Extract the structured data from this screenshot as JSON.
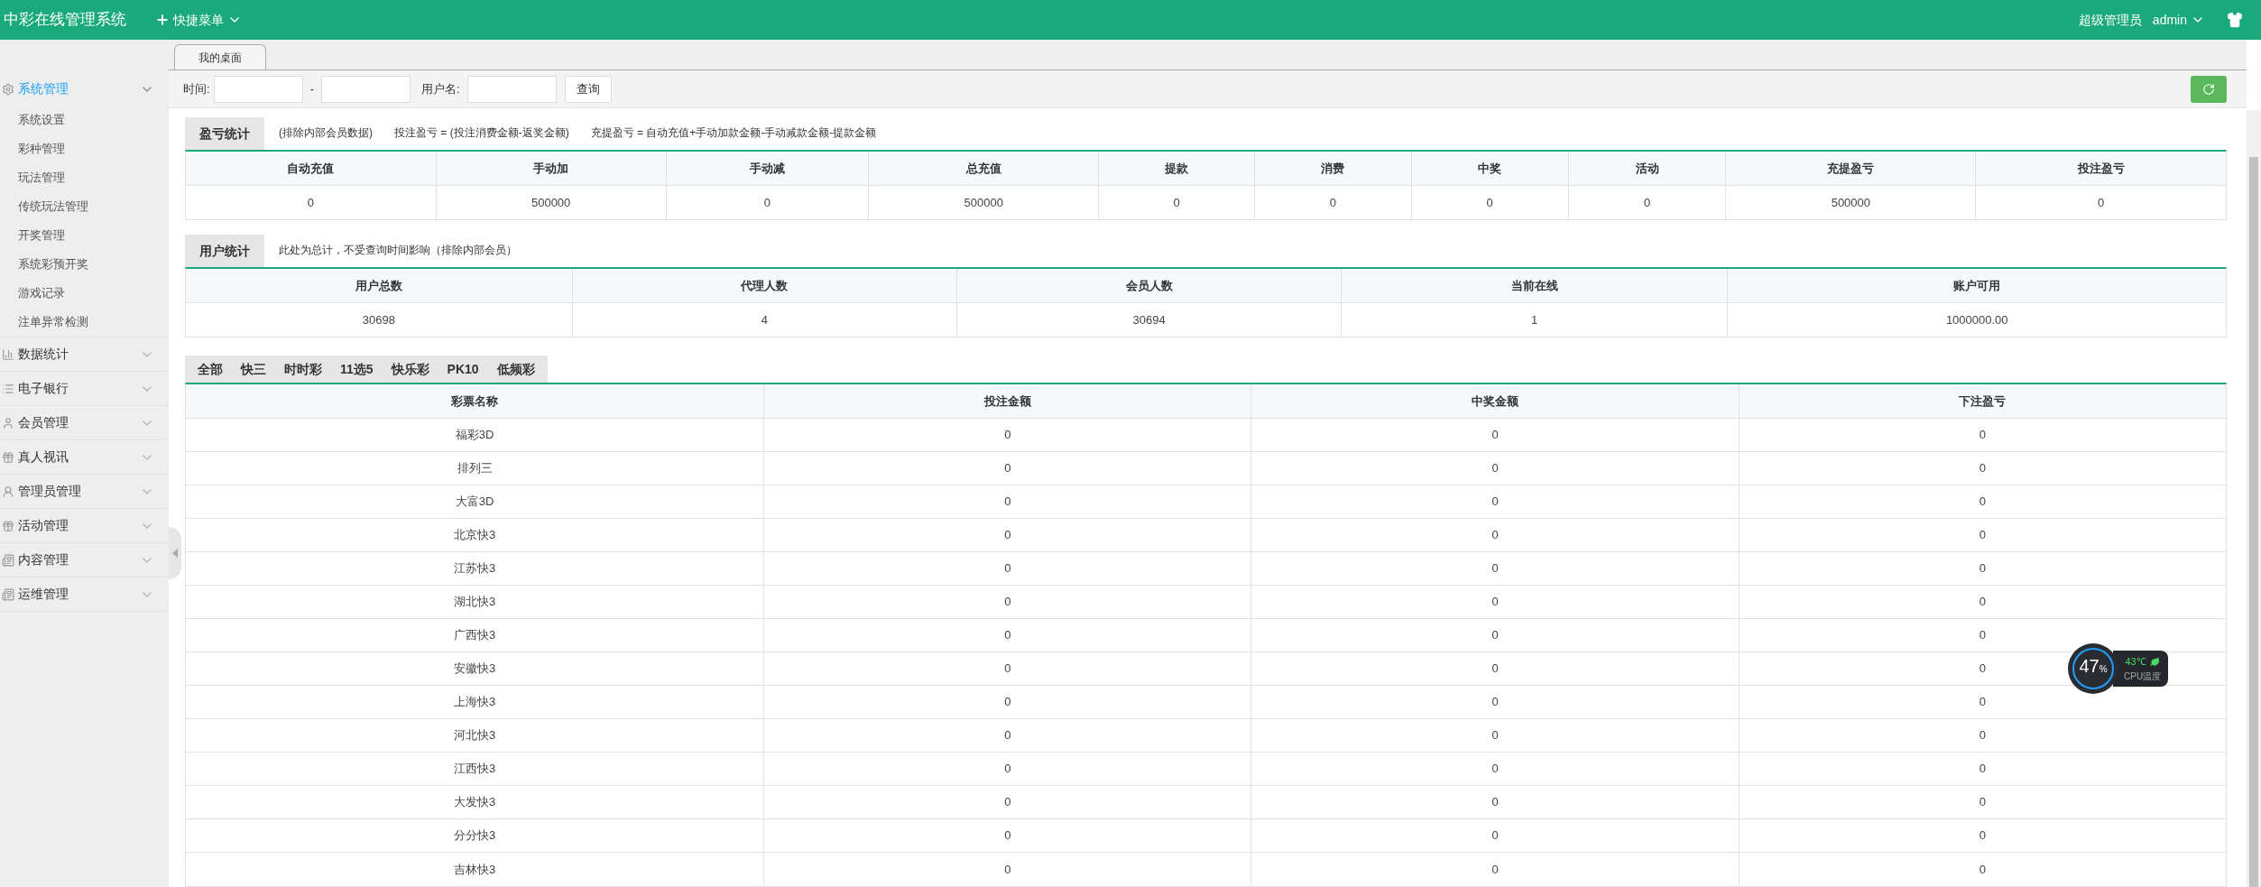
{
  "header": {
    "title": "中彩在线管理系统",
    "quick_menu": "快捷菜单",
    "role": "超级管理员",
    "user": "admin"
  },
  "sidebar": {
    "groups": [
      {
        "label": "系统管理",
        "expanded": true,
        "selected": true,
        "children": [
          {
            "label": "系统设置"
          },
          {
            "label": "彩种管理"
          },
          {
            "label": "玩法管理"
          },
          {
            "label": "传统玩法管理"
          },
          {
            "label": "开奖管理"
          },
          {
            "label": "系统彩预开奖"
          },
          {
            "label": "游戏记录"
          },
          {
            "label": "注单异常检测"
          }
        ]
      },
      {
        "label": "数据统计",
        "expanded": false,
        "selected": false
      },
      {
        "label": "电子银行",
        "expanded": false,
        "selected": false
      },
      {
        "label": "会员管理",
        "expanded": false,
        "selected": false
      },
      {
        "label": "真人视讯",
        "expanded": false,
        "selected": false
      },
      {
        "label": "管理员管理",
        "expanded": false,
        "selected": false
      },
      {
        "label": "活动管理",
        "expanded": false,
        "selected": false
      },
      {
        "label": "内容管理",
        "expanded": false,
        "selected": false
      },
      {
        "label": "运维管理",
        "expanded": false,
        "selected": false
      }
    ]
  },
  "page_tabs": [
    {
      "label": "我的桌面",
      "selected": true
    }
  ],
  "filter": {
    "time_label": "时间:",
    "separator": "-",
    "username_label": "用户名:",
    "search_button": "查询"
  },
  "profit_stats": {
    "title": "盈亏统计",
    "notes": [
      "(排除内部会员数据)",
      "投注盈亏 = (投注消费金额-返奖金额)",
      "充提盈亏 = 自动充值+手动加款金额-手动减款金额-提款金额"
    ],
    "columns": [
      "自动充值",
      "手动加",
      "手动减",
      "总充值",
      "提款",
      "消费",
      "中奖",
      "活动",
      "充提盈亏",
      "投注盈亏"
    ],
    "rows": [
      [
        "0",
        "500000",
        "0",
        "500000",
        "0",
        "0",
        "0",
        "0",
        "500000",
        "0"
      ]
    ]
  },
  "user_stats": {
    "title": "用户统计",
    "notes": [
      "此处为总计，不受查询时间影响（排除内部会员）"
    ],
    "columns": [
      "用户总数",
      "代理人数",
      "会员人数",
      "当前在线",
      "账户可用"
    ],
    "rows": [
      [
        "30698",
        "4",
        "30694",
        "1",
        "1000000.00"
      ]
    ]
  },
  "lottery_tabs": [
    {
      "label": "全部"
    },
    {
      "label": "快三"
    },
    {
      "label": "时时彩"
    },
    {
      "label": "11选5"
    },
    {
      "label": "快乐彩"
    },
    {
      "label": "PK10"
    },
    {
      "label": "低频彩"
    }
  ],
  "lottery_table": {
    "columns": [
      "彩票名称",
      "投注金额",
      "中奖金额",
      "下注盈亏"
    ],
    "rows": [
      [
        "福彩3D",
        "0",
        "0",
        "0"
      ],
      [
        "排列三",
        "0",
        "0",
        "0"
      ],
      [
        "大富3D",
        "0",
        "0",
        "0"
      ],
      [
        "北京快3",
        "0",
        "0",
        "0"
      ],
      [
        "江苏快3",
        "0",
        "0",
        "0"
      ],
      [
        "湖北快3",
        "0",
        "0",
        "0"
      ],
      [
        "广西快3",
        "0",
        "0",
        "0"
      ],
      [
        "安徽快3",
        "0",
        "0",
        "0"
      ],
      [
        "上海快3",
        "0",
        "0",
        "0"
      ],
      [
        "河北快3",
        "0",
        "0",
        "0"
      ],
      [
        "江西快3",
        "0",
        "0",
        "0"
      ],
      [
        "大发快3",
        "0",
        "0",
        "0"
      ],
      [
        "分分快3",
        "0",
        "0",
        "0"
      ],
      [
        "吉林快3",
        "0",
        "0",
        "0"
      ]
    ]
  },
  "cpu_widget": {
    "percent": "47",
    "unit": "%",
    "temperature": "43℃",
    "label": "CPU温度"
  }
}
